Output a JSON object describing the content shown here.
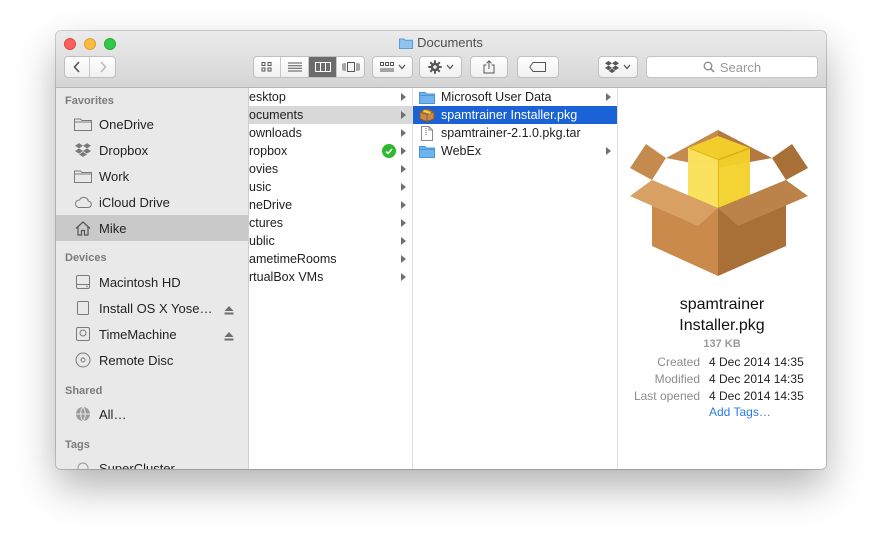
{
  "window": {
    "title": "Documents"
  },
  "toolbar": {
    "search_placeholder": "Search"
  },
  "sidebar": {
    "favorites_header": "Favorites",
    "favorites": [
      {
        "label": "OneDrive"
      },
      {
        "label": "Dropbox"
      },
      {
        "label": "Work"
      },
      {
        "label": "iCloud Drive"
      },
      {
        "label": "Mike"
      }
    ],
    "devices_header": "Devices",
    "devices": [
      {
        "label": "Macintosh HD"
      },
      {
        "label": "Install OS X Yose…"
      },
      {
        "label": "TimeMachine"
      },
      {
        "label": "Remote Disc"
      }
    ],
    "shared_header": "Shared",
    "shared": [
      {
        "label": "All…"
      }
    ],
    "tags_header": "Tags",
    "tags": [
      {
        "label": "SuperCluster"
      }
    ]
  },
  "column1": {
    "items": [
      {
        "label": "esktop"
      },
      {
        "label": "ocuments"
      },
      {
        "label": "ownloads"
      },
      {
        "label": "ropbox"
      },
      {
        "label": "ovies"
      },
      {
        "label": "usic"
      },
      {
        "label": "neDrive"
      },
      {
        "label": "ctures"
      },
      {
        "label": "ublic"
      },
      {
        "label": "ametimeRooms"
      },
      {
        "label": "rtualBox VMs"
      }
    ]
  },
  "column2": {
    "items": [
      {
        "label": "Microsoft User Data"
      },
      {
        "label": "spamtrainer Installer.pkg"
      },
      {
        "label": "spamtrainer-2.1.0.pkg.tar"
      },
      {
        "label": "WebEx"
      }
    ]
  },
  "preview": {
    "name_line1": "spamtrainer",
    "name_line2": "Installer.pkg",
    "size": "137 KB",
    "created_label": "Created",
    "created_value": "4 Dec 2014 14:35",
    "modified_label": "Modified",
    "modified_value": "4 Dec 2014 14:35",
    "opened_label": "Last opened",
    "opened_value": "4 Dec 2014 14:35",
    "add_tags": "Add Tags…"
  },
  "colors": {
    "selection": "#1a62d6",
    "link": "#2c7be5"
  }
}
